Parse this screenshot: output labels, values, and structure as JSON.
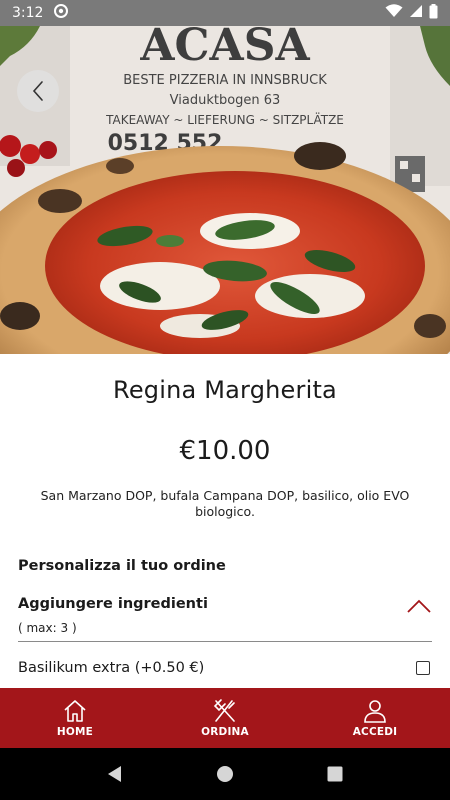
{
  "status": {
    "time": "3:12"
  },
  "hero": {
    "sign_name": "ACASA",
    "sign_line1": "BESTE PIZZERIA IN INNSBRUCK",
    "sign_line2": "Viaduktbogen 63",
    "sign_line3": "TAKEAWAY ~ LIEFERUNG ~ SITZPLÄTZE",
    "sign_phone": "0512 552"
  },
  "product": {
    "title": "Regina Margherita",
    "price": "€10.00",
    "description": "San Marzano DOP, bufala Campana DOP, basilico, olio EVO biologico."
  },
  "customize": {
    "section_title": "Personalizza il tuo ordine",
    "group_title": "Aggiungere ingredienti",
    "group_max": "(  max: 3 )",
    "options": [
      {
        "label": "Basilikum extra (+0.50 €)",
        "checked": false
      }
    ]
  },
  "nav": {
    "items": [
      {
        "label": "HOME",
        "icon": "home-icon"
      },
      {
        "label": "ORDINA",
        "icon": "fork-knife-icon"
      },
      {
        "label": "ACCEDI",
        "icon": "user-icon"
      }
    ]
  },
  "colors": {
    "accent": "#a3161a",
    "status_bar": "#7a7a7a"
  }
}
